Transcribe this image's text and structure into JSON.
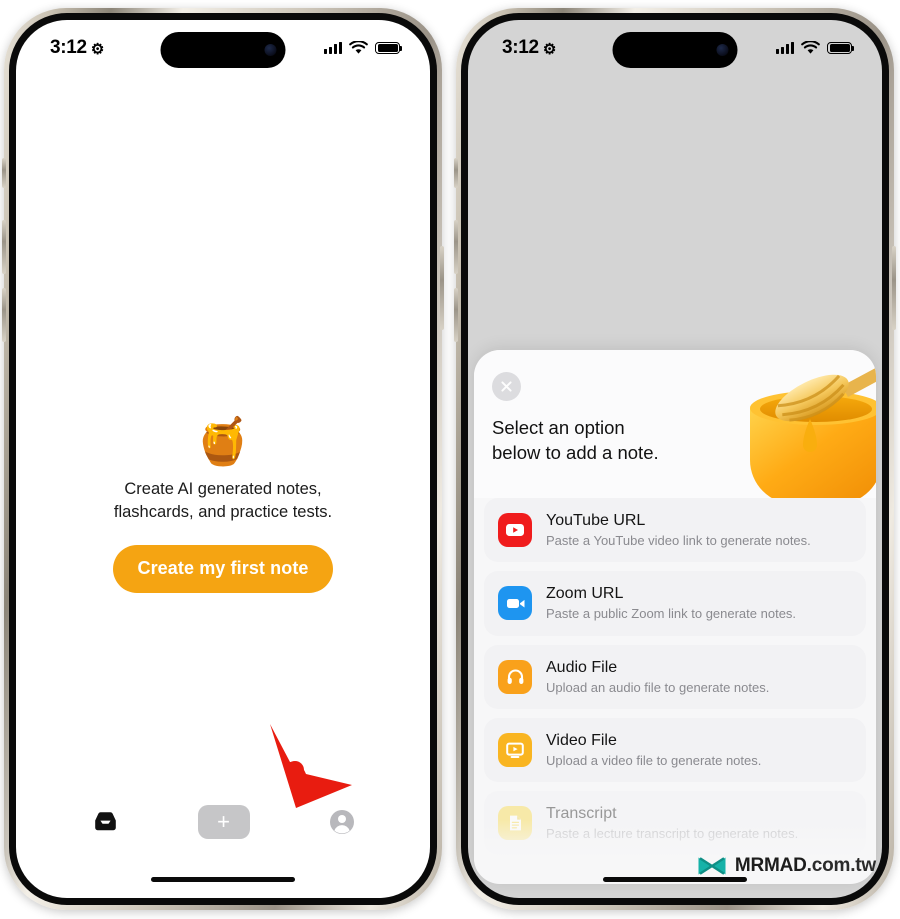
{
  "page": {
    "watermark": {
      "brand": "MRMAD",
      "tld": ".com.tw",
      "logo_icon": "mrmad-bowtie-logo-icon",
      "accent": "#16b2a8"
    }
  },
  "status_bar": {
    "time": "3:12",
    "gear_icon": "gear-icon",
    "signal_icon": "cellular-signal-icon",
    "wifi_icon": "wifi-icon",
    "battery_icon": "battery-full-icon"
  },
  "left_phone": {
    "screen_background": "#ffffff",
    "empty_state": {
      "illustration_icon": "honey-pot-emoji",
      "illustration_glyph": "🍯",
      "line1": "Create AI generated notes,",
      "line2": "flashcards, and practice tests.",
      "cta_label": "Create my first note",
      "cta_color": "#f5a412"
    },
    "tab_bar": {
      "items": [
        {
          "name": "inbox",
          "icon": "inbox-tray-icon",
          "label": ""
        },
        {
          "name": "add",
          "icon": "plus-icon",
          "label": "+"
        },
        {
          "name": "profile",
          "icon": "account-circle-icon",
          "label": ""
        }
      ]
    },
    "annotation": {
      "arrow_icon": "red-pointer-arrow-icon",
      "arrow_color": "#e81c10"
    }
  },
  "right_phone": {
    "screen_background": "#d4d4d4",
    "sheet": {
      "close_icon": "close-x-icon",
      "title_line1": "Select an option",
      "title_line2": "below to add a note.",
      "header_art_icon": "honey-pot-dipper-illustration",
      "options": [
        {
          "icon": "youtube-icon",
          "icon_color": "#f01c1c",
          "title": "YouTube URL",
          "subtitle": "Paste a YouTube video link to generate notes.",
          "faded": false
        },
        {
          "icon": "zoom-video-icon",
          "icon_color": "#1e95f0",
          "title": "Zoom URL",
          "subtitle": "Paste a public Zoom link to generate notes.",
          "faded": false
        },
        {
          "icon": "headphones-icon",
          "icon_color": "#f9a11b",
          "title": "Audio File",
          "subtitle": "Upload an audio file to generate notes.",
          "faded": false
        },
        {
          "icon": "video-monitor-icon",
          "icon_color": "#f9b521",
          "title": "Video File",
          "subtitle": "Upload a video file to generate notes.",
          "faded": false
        },
        {
          "icon": "document-text-icon",
          "icon_color": "#f7d63c",
          "title": "Transcript",
          "subtitle": "Paste a lecture transcript to generate notes.",
          "faded": true
        }
      ]
    }
  }
}
